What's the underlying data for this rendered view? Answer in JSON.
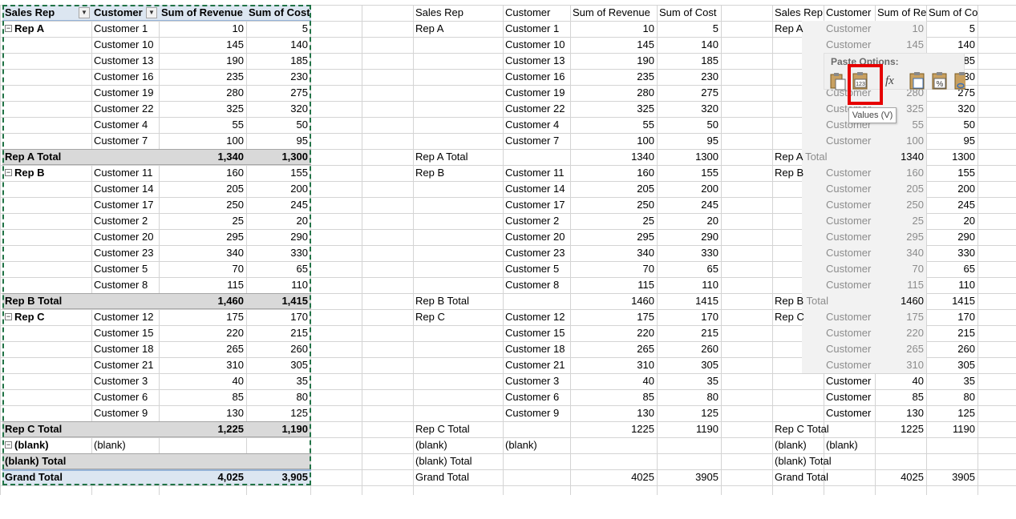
{
  "pivot_headers": [
    "Sales Rep",
    "Customer",
    "Sum of Revenue",
    "Sum of Cost"
  ],
  "plain_headers": [
    "Sales Rep",
    "Customer",
    "Sum of Revenue",
    "Sum of Cost"
  ],
  "right_headers": [
    "Sales Rep",
    "Customer",
    "Sum of Re",
    "Sum of Cost"
  ],
  "rows": [
    {
      "type": "rep",
      "rep": "Rep A",
      "customer": "Customer 1",
      "rev": "10",
      "cost": "5"
    },
    {
      "type": "item",
      "customer": "Customer 10",
      "rev": "145",
      "cost": "140"
    },
    {
      "type": "item",
      "customer": "Customer 13",
      "rev": "190",
      "cost": "185"
    },
    {
      "type": "item",
      "customer": "Customer 16",
      "rev": "235",
      "cost": "230"
    },
    {
      "type": "item",
      "customer": "Customer 19",
      "rev": "280",
      "cost": "275"
    },
    {
      "type": "item",
      "customer": "Customer 22",
      "rev": "325",
      "cost": "320"
    },
    {
      "type": "item",
      "customer": "Customer 4",
      "rev": "55",
      "cost": "50"
    },
    {
      "type": "item",
      "customer": "Customer 7",
      "rev": "100",
      "cost": "95"
    },
    {
      "type": "total",
      "label": "Rep A Total",
      "rev": "1,340",
      "cost": "1,300",
      "rev_plain": "1340",
      "cost_plain": "1300"
    },
    {
      "type": "rep",
      "rep": "Rep B",
      "customer": "Customer 11",
      "rev": "160",
      "cost": "155"
    },
    {
      "type": "item",
      "customer": "Customer 14",
      "rev": "205",
      "cost": "200"
    },
    {
      "type": "item",
      "customer": "Customer 17",
      "rev": "250",
      "cost": "245"
    },
    {
      "type": "item",
      "customer": "Customer 2",
      "rev": "25",
      "cost": "20"
    },
    {
      "type": "item",
      "customer": "Customer 20",
      "rev": "295",
      "cost": "290"
    },
    {
      "type": "item",
      "customer": "Customer 23",
      "rev": "340",
      "cost": "330"
    },
    {
      "type": "item",
      "customer": "Customer 5",
      "rev": "70",
      "cost": "65"
    },
    {
      "type": "item",
      "customer": "Customer 8",
      "rev": "115",
      "cost": "110"
    },
    {
      "type": "total",
      "label": "Rep B Total",
      "rev": "1,460",
      "cost": "1,415",
      "rev_plain": "1460",
      "cost_plain": "1415"
    },
    {
      "type": "rep",
      "rep": "Rep C",
      "customer": "Customer 12",
      "rev": "175",
      "cost": "170"
    },
    {
      "type": "item",
      "customer": "Customer 15",
      "rev": "220",
      "cost": "215"
    },
    {
      "type": "item",
      "customer": "Customer 18",
      "rev": "265",
      "cost": "260"
    },
    {
      "type": "item",
      "customer": "Customer 21",
      "rev": "310",
      "cost": "305"
    },
    {
      "type": "item",
      "customer": "Customer 3",
      "rev": "40",
      "cost": "35"
    },
    {
      "type": "item",
      "customer": "Customer 6",
      "rev": "85",
      "cost": "80"
    },
    {
      "type": "item",
      "customer": "Customer 9",
      "rev": "130",
      "cost": "125"
    },
    {
      "type": "total",
      "label": "Rep C Total",
      "rev": "1,225",
      "cost": "1,190",
      "rev_plain": "1225",
      "cost_plain": "1190"
    },
    {
      "type": "rep",
      "rep": "(blank)",
      "customer": "(blank)",
      "rev": "",
      "cost": ""
    },
    {
      "type": "total",
      "label": "(blank) Total",
      "rev": "",
      "cost": "",
      "rev_plain": "",
      "cost_plain": ""
    },
    {
      "type": "grand",
      "label": "Grand Total",
      "rev": "4,025",
      "cost": "3,905",
      "rev_plain": "4025",
      "cost_plain": "3905"
    }
  ],
  "right_rep_labels": {
    "Rep A": [
      "Rep A",
      ""
    ],
    "Rep B": [
      "Rep B",
      ""
    ],
    "Rep C": [
      "Rep C",
      ""
    ],
    "(blank)": [
      "(blank)",
      ""
    ]
  },
  "right_total_split": {
    "Rep A Total": [
      "Rep A",
      "Total"
    ],
    "Rep B Total": [
      "Rep B",
      "Total"
    ],
    "Rep C Total": [
      "Rep C",
      "Total"
    ],
    "(blank) Total": [
      "(blank)",
      "Total"
    ],
    "Grand Total": [
      "Grand",
      "Total"
    ]
  },
  "right_customer_short": "Customer",
  "paste_menu": {
    "title": "Paste Options:",
    "tooltip": "Values (V)",
    "buttons": [
      "paste-icon",
      "paste-values-icon",
      "paste-formulas-icon",
      "paste-formatting-icon",
      "paste-percent-icon",
      "paste-link-icon"
    ],
    "values_label": "123",
    "fx_label": "fx",
    "percent_label": "%"
  },
  "colors": {
    "header": "#dce6f1",
    "total": "#d9d9d9",
    "marquee": "#217346",
    "highlight": "#e60000"
  }
}
